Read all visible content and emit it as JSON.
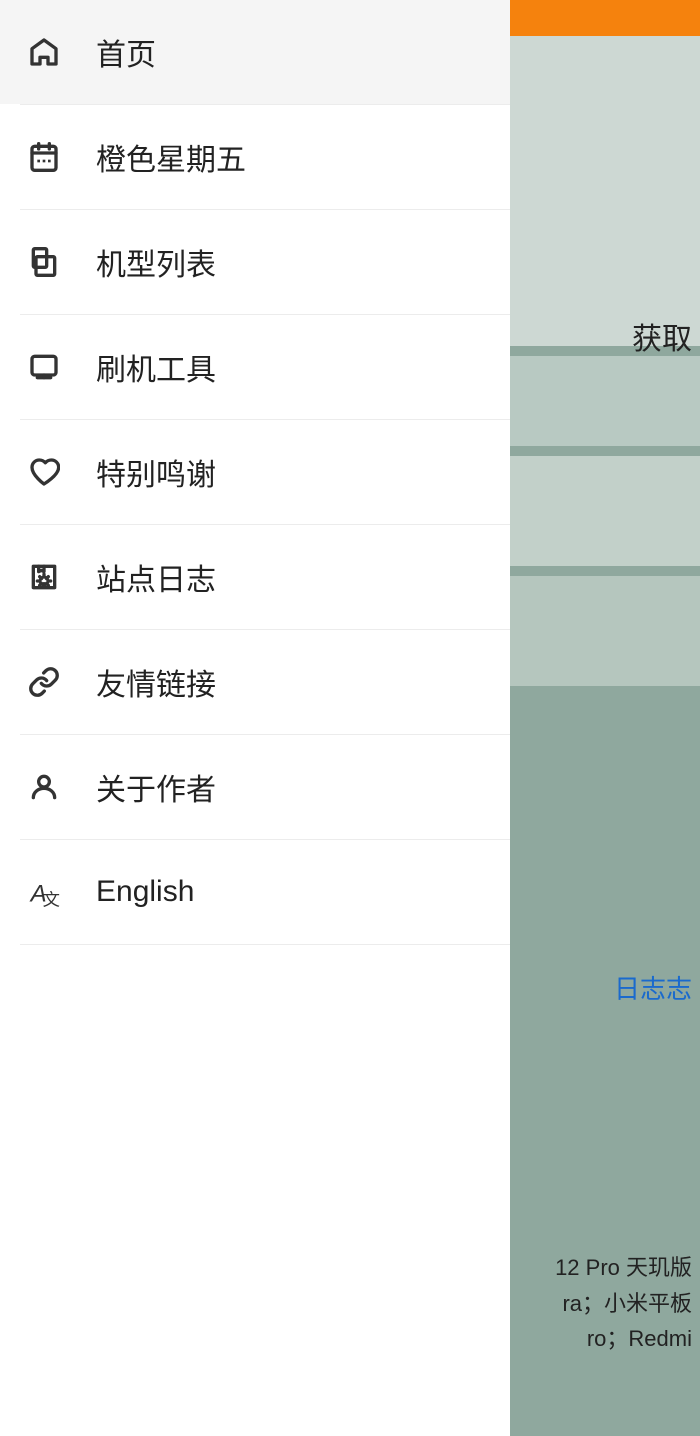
{
  "sidebar": {
    "items": [
      {
        "id": "home",
        "label": "首页",
        "icon": "home"
      },
      {
        "id": "orange-friday",
        "label": "橙色星期五",
        "icon": "orange-friday"
      },
      {
        "id": "model-list",
        "label": "机型列表",
        "icon": "model-list"
      },
      {
        "id": "flash-tool",
        "label": "刷机工具",
        "icon": "flash-tool"
      },
      {
        "id": "special-thanks",
        "label": "特别鸣谢",
        "icon": "special-thanks"
      },
      {
        "id": "site-log",
        "label": "站点日志",
        "icon": "site-log"
      },
      {
        "id": "friendly-links",
        "label": "友情链接",
        "icon": "friendly-links"
      },
      {
        "id": "about-author",
        "label": "关于作者",
        "icon": "about-author"
      },
      {
        "id": "english",
        "label": "English",
        "icon": "language"
      }
    ]
  },
  "right": {
    "huoqu": "获取",
    "log_label": "日志",
    "bottom_text": "12 Pro 天玑版\nra；小米平板\nro；Redmi"
  }
}
